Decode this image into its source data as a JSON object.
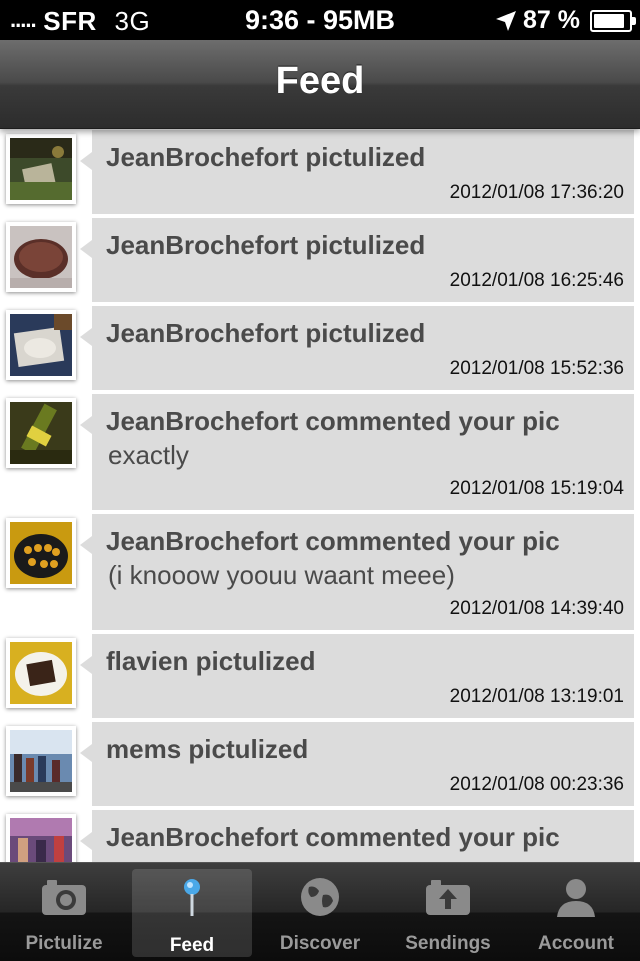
{
  "status_bar": {
    "signal": ".....",
    "carrier": "SFR",
    "network": "3G",
    "center": "9:36 - 95MB",
    "battery_percent": "87 %",
    "battery_level": 0.87
  },
  "nav": {
    "title": "Feed"
  },
  "feed": {
    "items": [
      {
        "who": "JeanBrochefort pictulized",
        "message": "",
        "time": "2012/01/08 17:36:20"
      },
      {
        "who": "JeanBrochefort pictulized",
        "message": "",
        "time": "2012/01/08 16:25:46"
      },
      {
        "who": "JeanBrochefort pictulized",
        "message": "",
        "time": "2012/01/08 15:52:36"
      },
      {
        "who": "JeanBrochefort commented your pic",
        "message": "exactly",
        "time": "2012/01/08 15:19:04"
      },
      {
        "who": "JeanBrochefort commented your pic",
        "message": "(i knooow yoouu waant meee)",
        "time": "2012/01/08 14:39:40"
      },
      {
        "who": "flavien pictulized",
        "message": "",
        "time": "2012/01/08 13:19:01"
      },
      {
        "who": "mems pictulized",
        "message": "",
        "time": "2012/01/08 00:23:36"
      },
      {
        "who": "JeanBrochefort commented your pic",
        "message": "",
        "time": ""
      }
    ]
  },
  "tabs": [
    {
      "label": "Pictulize",
      "icon": "camera-icon"
    },
    {
      "label": "Feed",
      "icon": "pin-icon",
      "active": true
    },
    {
      "label": "Discover",
      "icon": "globe-icon"
    },
    {
      "label": "Sendings",
      "icon": "upload-icon"
    },
    {
      "label": "Account",
      "icon": "person-icon"
    }
  ]
}
